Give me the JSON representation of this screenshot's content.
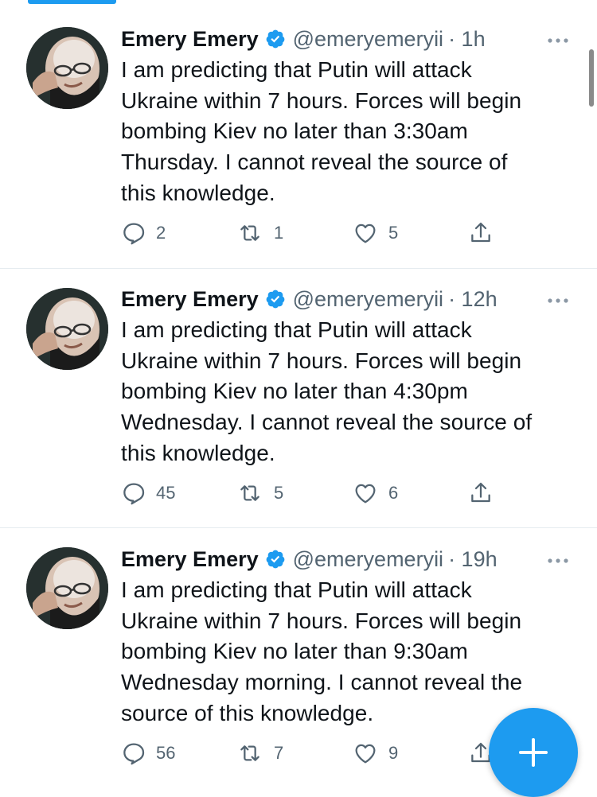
{
  "tweets": [
    {
      "name": "Emery Emery",
      "handle": "@emeryemeryii",
      "time": "· 1h",
      "text_lines": [
        "I am predicting that Putin will attack",
        "Ukraine within 7 hours. Forces will begin",
        "bombing Kiev no later than 3:30am",
        "Thursday. I cannot reveal the source of",
        "this knowledge."
      ],
      "replies": "2",
      "retweets": "1",
      "likes": "5"
    },
    {
      "name": "Emery Emery",
      "handle": "@emeryemeryii",
      "time": "· 12h",
      "text_lines": [
        "I am predicting that Putin will attack",
        "Ukraine within 7 hours. Forces will begin",
        "bombing Kiev no later than 4:30pm",
        "Wednesday. I cannot reveal the source of",
        "this knowledge."
      ],
      "replies": "45",
      "retweets": "5",
      "likes": "6"
    },
    {
      "name": "Emery Emery",
      "handle": "@emeryemeryii",
      "time": "· 19h",
      "text_lines": [
        "I am predicting that Putin will attack",
        "Ukraine within 7 hours. Forces will begin",
        "bombing Kiev no later than 9:30am",
        "Wednesday morning. I cannot reveal the",
        "source of this knowledge."
      ],
      "replies": "56",
      "retweets": "7",
      "likes": "9"
    }
  ],
  "icons": {
    "verified": "verified-badge-icon",
    "more": "more-options-icon",
    "reply": "reply-icon",
    "retweet": "retweet-icon",
    "like": "like-icon",
    "share": "share-icon",
    "compose": "compose-plus-icon"
  },
  "colors": {
    "accent": "#1d9bf0",
    "text": "#0f1419",
    "secondary": "#536471",
    "divider": "#e6ecf0"
  }
}
